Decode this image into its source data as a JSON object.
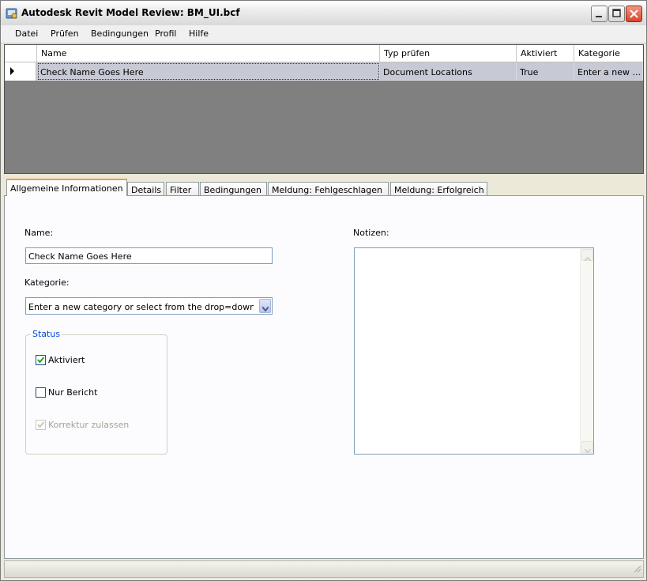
{
  "window": {
    "title": "Autodesk Revit Model Review: BM_UI.bcf",
    "icon": "revit-model-review-icon"
  },
  "menu": [
    "Datei",
    "Prüfen",
    "Bedingungen",
    "Profil",
    "Hilfe"
  ],
  "grid": {
    "columns": [
      "Name",
      "Typ prüfen",
      "Aktiviert",
      "Kategorie"
    ],
    "rows": [
      {
        "name": "Check Name Goes Here",
        "type": "Document Locations",
        "enabled": "True",
        "category": "Enter a new ..."
      }
    ]
  },
  "tabs": [
    "Allgemeine Informationen",
    "Details",
    "Filter",
    "Bedingungen",
    "Meldung: Fehlgeschlagen",
    "Meldung: Erfolgreich"
  ],
  "active_tab": "Allgemeine Informationen",
  "form": {
    "name_label": "Name:",
    "name_value": "Check Name Goes Here",
    "category_label": "Kategorie:",
    "category_value": "Enter a new category or select from the drop=down li",
    "status_title": "Status",
    "checkboxes": [
      {
        "label": "Aktiviert",
        "checked": true,
        "enabled": true
      },
      {
        "label": "Nur Bericht",
        "checked": false,
        "enabled": true
      },
      {
        "label": "Korrektur zulassen",
        "checked": true,
        "enabled": false
      }
    ],
    "notes_label": "Notizen:",
    "notes_value": ""
  },
  "colors": {
    "grid_background": "#808080",
    "selected_row": "#c7c9d4",
    "active_tab_accent": "#f0a037",
    "group_title": "#0046d5",
    "close_button": "#d9442b"
  }
}
